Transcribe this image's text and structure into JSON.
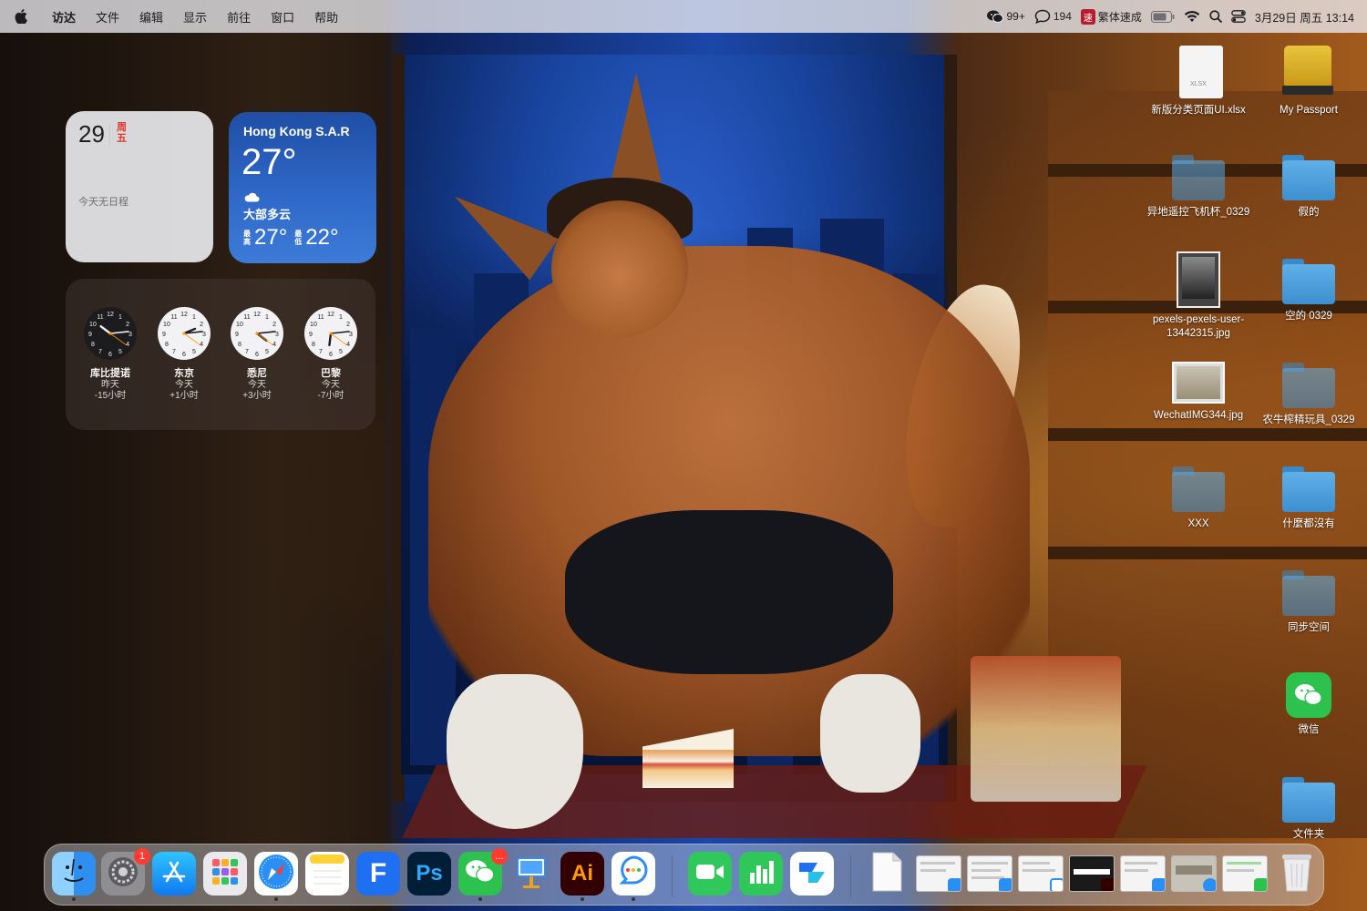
{
  "menubar": {
    "app_name": "访达",
    "menus": [
      "文件",
      "编辑",
      "显示",
      "前往",
      "窗口",
      "帮助"
    ],
    "wechat_count": "99+",
    "messages_count": "194",
    "ime_badge": "速",
    "ime_label": "繁体速成",
    "datetime": "3月29日 周五 13:14"
  },
  "widgets": {
    "calendar": {
      "day": "29",
      "weekday": "周五",
      "empty_text": "今天无日程"
    },
    "weather": {
      "city": "Hong Kong S.A.R",
      "temp": "27°",
      "condition": "大部多云",
      "high_label": "最高",
      "high": "27°",
      "low_label": "最低",
      "low": "22°"
    },
    "clocks": [
      {
        "city": "库比提诺",
        "day": "昨天",
        "offset": "-15小时",
        "hour": 22,
        "minute": 14
      },
      {
        "city": "东京",
        "day": "今天",
        "offset": "+1小时",
        "hour": 14,
        "minute": 14
      },
      {
        "city": "悉尼",
        "day": "今天",
        "offset": "+3小时",
        "hour": 16,
        "minute": 14
      },
      {
        "city": "巴黎",
        "day": "今天",
        "offset": "-7小时",
        "hour": 6,
        "minute": 14
      }
    ]
  },
  "desktop": {
    "items": [
      {
        "name": "新版分类页面UI.xlsx",
        "kind": "xlsx",
        "ext": "XLSX"
      },
      {
        "name": "My Passport",
        "kind": "drive"
      },
      {
        "name": "异地遥控飞机杯_0329",
        "kind": "folder"
      },
      {
        "name": "假的",
        "kind": "folder"
      },
      {
        "name": "pexels-pexels-user-13442315.jpg",
        "kind": "photo"
      },
      {
        "name": "空的 0329",
        "kind": "folder"
      },
      {
        "name": "WechatIMG344.jpg",
        "kind": "photo"
      },
      {
        "name": "农牛榨精玩具_0329",
        "kind": "folder"
      },
      {
        "name": "XXX",
        "kind": "folder"
      },
      {
        "name": "什麼都沒有",
        "kind": "folder"
      },
      {
        "name": "同步空间",
        "kind": "folder"
      },
      {
        "name": "微信",
        "kind": "app"
      },
      {
        "name": "文件夹",
        "kind": "folder"
      }
    ]
  },
  "dock": {
    "apps": [
      {
        "name": "Finder",
        "icon": "finder-icon"
      },
      {
        "name": "System Settings",
        "icon": "settings-icon",
        "badge": "1"
      },
      {
        "name": "App Store",
        "icon": "app-store-icon"
      },
      {
        "name": "Launchpad",
        "icon": "launchpad-icon"
      },
      {
        "name": "Safari",
        "icon": "safari-icon"
      },
      {
        "name": "Notes",
        "icon": "notes-icon"
      },
      {
        "name": "Feishu",
        "icon": "feishu-icon",
        "label": "F"
      },
      {
        "name": "Photoshop",
        "icon": "photoshop-icon",
        "label": "Ps"
      },
      {
        "name": "WeChat",
        "icon": "wechat-icon",
        "badge": "..."
      },
      {
        "name": "Keynote",
        "icon": "keynote-icon"
      },
      {
        "name": "Illustrator",
        "icon": "illustrator-icon",
        "label": "Ai"
      },
      {
        "name": "QQ Browser",
        "icon": "browser-icon"
      },
      {
        "name": "FaceTime",
        "icon": "facetime-icon"
      },
      {
        "name": "Numbers",
        "icon": "numbers-icon"
      },
      {
        "name": "Lark Docs",
        "icon": "lark-icon"
      },
      {
        "name": "Document",
        "icon": "document-icon"
      },
      {
        "name": "Trash",
        "icon": "trash-icon"
      }
    ]
  },
  "colors": {
    "accent_red": "#ff3b30",
    "folder_blue": "#4aa0dc",
    "weather_blue": "#2f68c8",
    "wechat_green": "#2dc14e"
  }
}
